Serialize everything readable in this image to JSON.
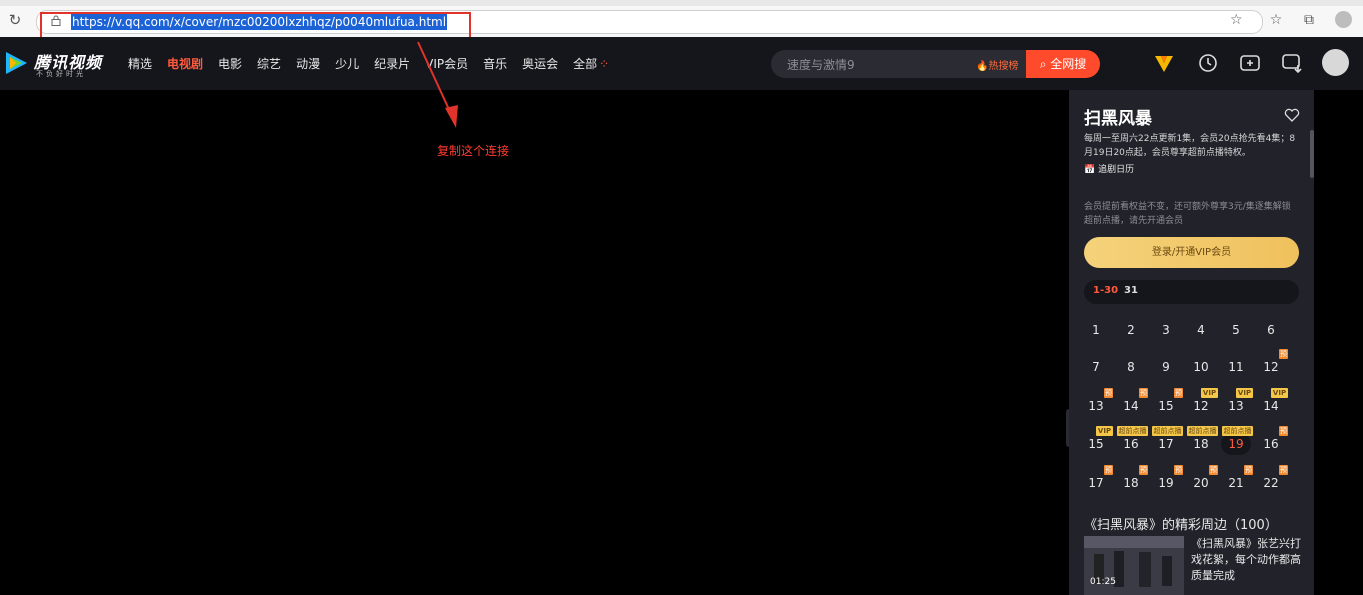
{
  "browser": {
    "url": "https://v.qq.com/x/cover/mzc00200lxzhhqz/p0040mlufua.html"
  },
  "site": {
    "logo_text": "腾讯视频",
    "logo_sub": "不负好时光",
    "nav": [
      "精选",
      "电视剧",
      "电影",
      "综艺",
      "动漫",
      "少儿",
      "纪录片",
      "VIP会员",
      "音乐",
      "奥运会",
      "全部"
    ],
    "nav_active_index": 1,
    "search_placeholder": "速度与激情9",
    "hot_label": "热搜榜",
    "search_button": "全网搜"
  },
  "annotation": {
    "text": "复制这个连接"
  },
  "side_panel": {
    "title": "扫黑风暴",
    "description": "每周一至周六22点更新1集，会员20点抢先看4集；8月19日20点起，会员尊享超前点播特权。",
    "calendar_label": "追剧日历",
    "note": "会员提前看权益不变，还可额外尊享3元/集逐集解锁超前点播，请先开通会员",
    "vip_button": "登录/开通VIP会员",
    "ranges": [
      "1-30",
      "31"
    ],
    "episodes": [
      {
        "num": "1",
        "tag": ""
      },
      {
        "num": "2",
        "tag": ""
      },
      {
        "num": "3",
        "tag": ""
      },
      {
        "num": "4",
        "tag": ""
      },
      {
        "num": "5",
        "tag": ""
      },
      {
        "num": "6",
        "tag": ""
      },
      {
        "num": "7",
        "tag": ""
      },
      {
        "num": "8",
        "tag": ""
      },
      {
        "num": "9",
        "tag": ""
      },
      {
        "num": "10",
        "tag": ""
      },
      {
        "num": "11",
        "tag": ""
      },
      {
        "num": "12",
        "tag": "预"
      },
      {
        "num": "13",
        "tag": "预"
      },
      {
        "num": "14",
        "tag": "预"
      },
      {
        "num": "15",
        "tag": "预"
      },
      {
        "num": "12",
        "tag": "VIP"
      },
      {
        "num": "13",
        "tag": "VIP"
      },
      {
        "num": "14",
        "tag": "VIP"
      },
      {
        "num": "15",
        "tag": "VIP"
      },
      {
        "num": "16",
        "tag": "超前点播"
      },
      {
        "num": "17",
        "tag": "超前点播"
      },
      {
        "num": "18",
        "tag": "超前点播"
      },
      {
        "num": "19",
        "tag": "超前点播"
      },
      {
        "num": "16",
        "tag": "预"
      },
      {
        "num": "17",
        "tag": "预"
      },
      {
        "num": "18",
        "tag": "预"
      },
      {
        "num": "19",
        "tag": "预"
      },
      {
        "num": "20",
        "tag": "预"
      },
      {
        "num": "21",
        "tag": "预"
      },
      {
        "num": "22",
        "tag": "预"
      }
    ],
    "current_episode_index": 22,
    "section_title": "《扫黑风暴》的精彩周边（100）",
    "video": {
      "title": "《扫黑风暴》张艺兴打戏花絮，每个动作都高质量完成",
      "duration": "01:25"
    }
  },
  "colors": {
    "accent": "#ff4a2c",
    "annotation": "#e0332a",
    "vip_gold": "#f5c748"
  }
}
